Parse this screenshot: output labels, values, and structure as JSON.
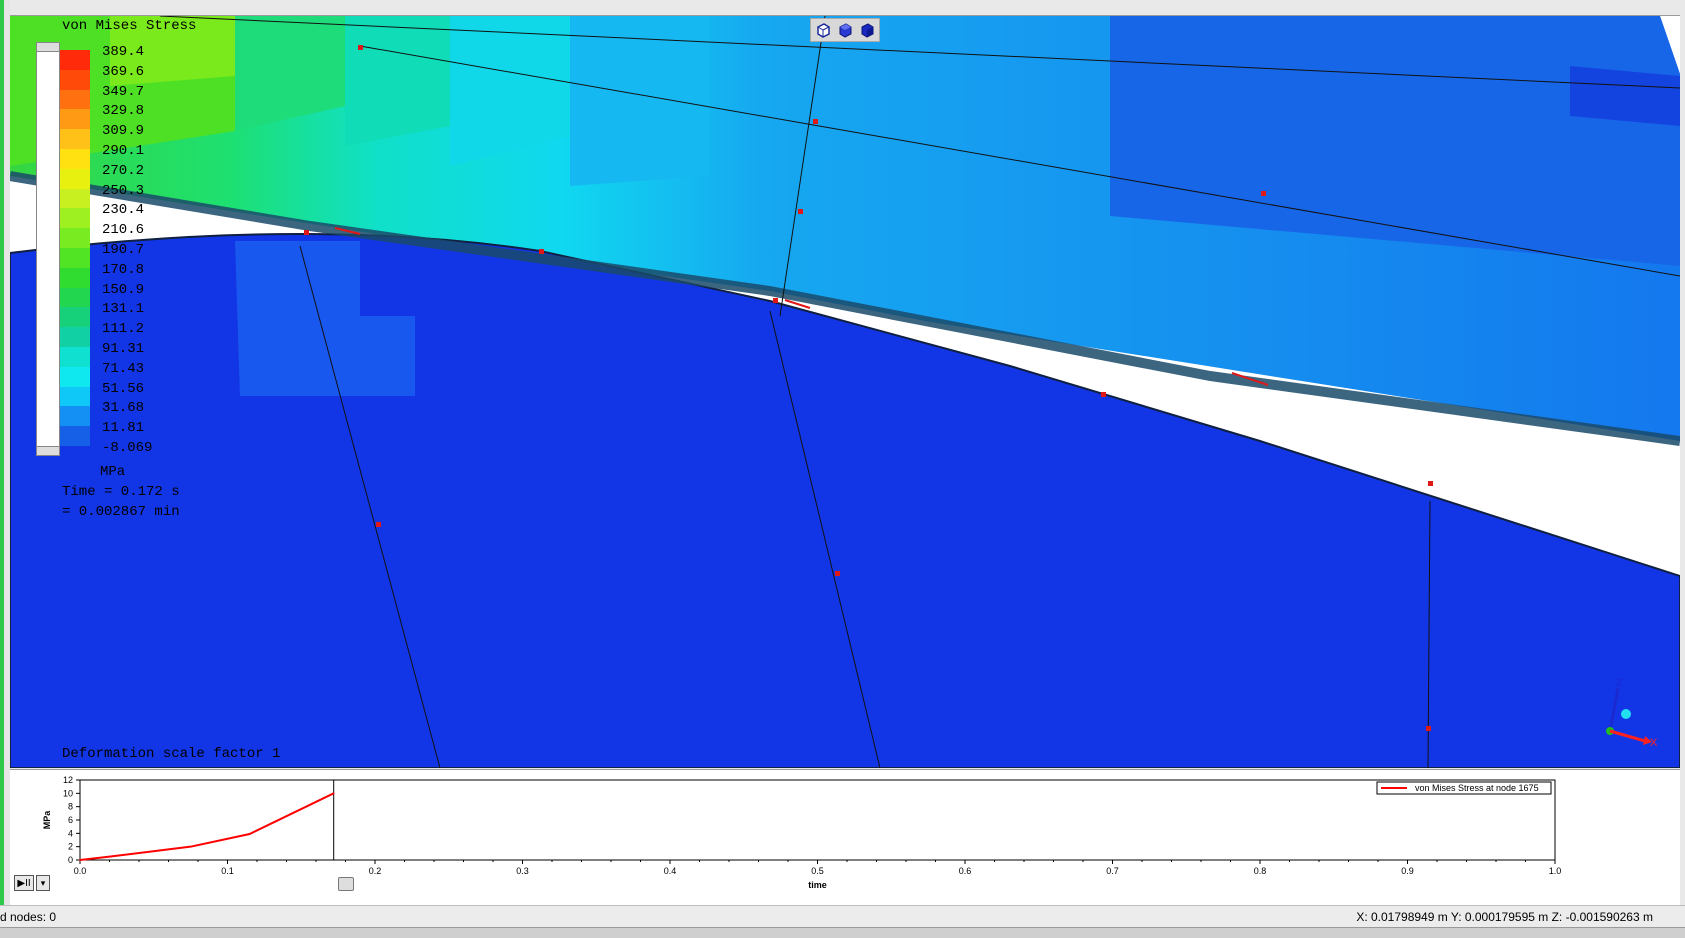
{
  "legend": {
    "title": "von Mises Stress",
    "levels": [
      "389.4",
      "369.6",
      "349.7",
      "329.8",
      "309.9",
      "290.1",
      "270.2",
      "250.3",
      "230.4",
      "210.6",
      "190.7",
      "170.8",
      "150.9",
      "131.1",
      "111.2",
      "91.31",
      "71.43",
      "51.56",
      "31.68",
      "11.81",
      "-8.069"
    ],
    "colors": [
      "#ff2a0a",
      "#ff4a0a",
      "#ff7010",
      "#ff9a14",
      "#ffc018",
      "#ffe010",
      "#e8f010",
      "#c8f020",
      "#9ef020",
      "#78ec20",
      "#50e424",
      "#30dc30",
      "#22d650",
      "#16d07a",
      "#10d0a4",
      "#10e0d0",
      "#10e8f0",
      "#10c8f8",
      "#1490f4",
      "#1660e8",
      "#1438e0"
    ],
    "unit": "MPa",
    "time": "Time = 0.172 s",
    "time_min": "= 0.002867 min"
  },
  "viewport": {
    "deformation": "Deformation scale factor 1",
    "view_buttons": [
      "iso-view-icon",
      "front-view-icon",
      "solid-view-icon"
    ],
    "triad": {
      "x": "X",
      "z": "Z"
    }
  },
  "plot": {
    "legend_label": "von Mises Stress at node 1675",
    "ylabel": "MPa",
    "xlabel": "time"
  },
  "chart_data": {
    "type": "line",
    "xlabel": "time",
    "ylabel": "MPa",
    "xlim": [
      0,
      1
    ],
    "ylim": [
      0,
      12
    ],
    "x_ticks": [
      "0.0",
      "0.1",
      "0.2",
      "0.3",
      "0.4",
      "0.5",
      "0.6",
      "0.7",
      "0.8",
      "0.9",
      "1.0"
    ],
    "y_ticks": [
      "0",
      "2",
      "4",
      "6",
      "8",
      "10",
      "12"
    ],
    "cursor_x": 0.172,
    "series": [
      {
        "name": "von Mises Stress at node 1675",
        "color": "#ff0000",
        "x": [
          0.0,
          0.02,
          0.075,
          0.115,
          0.172
        ],
        "y": [
          0.0,
          0.5,
          2.0,
          3.9,
          10.0
        ]
      }
    ]
  },
  "playback": {
    "play_label": "▶II",
    "menu_label": "▾"
  },
  "status": {
    "left": "d nodes: 0",
    "right": "X: 0.01798949 m Y: 0.000179595 m Z: -0.001590263 m"
  }
}
